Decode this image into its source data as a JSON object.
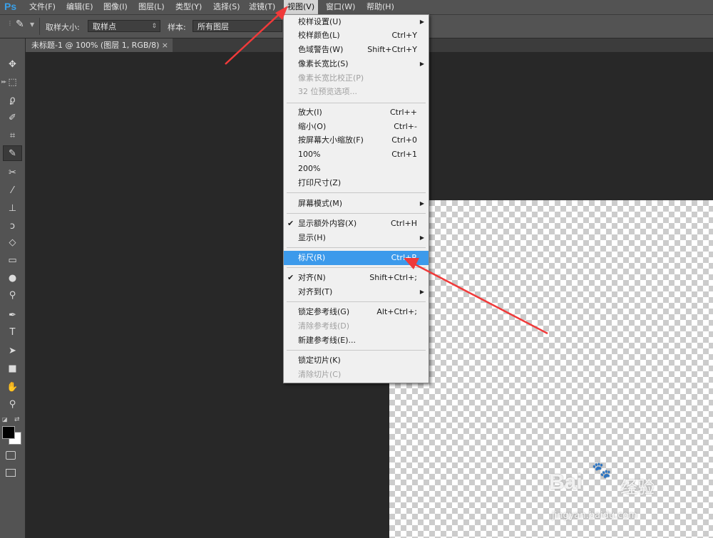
{
  "app": {
    "logo": "Ps"
  },
  "menubar": {
    "items": [
      "文件(F)",
      "编辑(E)",
      "图像(I)",
      "图层(L)",
      "类型(Y)",
      "选择(S)",
      "滤镜(T)",
      "视图(V)",
      "窗口(W)",
      "帮助(H)"
    ],
    "active": "视图(V)"
  },
  "options": {
    "sample_size_label": "取样大小:",
    "sample_size_value": "取样点",
    "sample_label": "样本:",
    "sample_value": "所有图层"
  },
  "document": {
    "tab_title": "未标题-1 @ 100% (图层 1, RGB/8)",
    "close": "×"
  },
  "toolbar": {
    "tools": [
      "move-tool",
      "marquee-tool",
      "lasso-tool",
      "quick-select-tool",
      "crop-tool",
      "eyedropper-tool",
      "healing-tool",
      "brush-tool",
      "stamp-tool",
      "history-brush-tool",
      "eraser-tool",
      "gradient-tool",
      "blur-tool",
      "dodge-tool",
      "pen-tool",
      "type-tool",
      "path-select-tool",
      "shape-tool",
      "hand-tool",
      "zoom-tool"
    ],
    "selected": "eyedropper-tool"
  },
  "view_menu": {
    "items": [
      {
        "label": "校样设置(U)",
        "shortcut": "",
        "submenu": true,
        "disabled": false
      },
      {
        "label": "校样颜色(L)",
        "shortcut": "Ctrl+Y",
        "disabled": false
      },
      {
        "label": "色域警告(W)",
        "shortcut": "Shift+Ctrl+Y",
        "disabled": false
      },
      {
        "label": "像素长宽比(S)",
        "shortcut": "",
        "submenu": true,
        "disabled": false
      },
      {
        "label": "像素长宽比校正(P)",
        "shortcut": "",
        "disabled": true
      },
      {
        "label": "32 位预览选项...",
        "shortcut": "",
        "disabled": true
      },
      {
        "label": "放大(I)",
        "shortcut": "Ctrl++",
        "disabled": false
      },
      {
        "label": "缩小(O)",
        "shortcut": "Ctrl+-",
        "disabled": false
      },
      {
        "label": "按屏幕大小缩放(F)",
        "shortcut": "Ctrl+0",
        "disabled": false
      },
      {
        "label": "100%",
        "shortcut": "Ctrl+1",
        "disabled": false
      },
      {
        "label": "200%",
        "shortcut": "",
        "disabled": false
      },
      {
        "label": "打印尺寸(Z)",
        "shortcut": "",
        "disabled": false
      },
      {
        "label": "屏幕模式(M)",
        "shortcut": "",
        "submenu": true,
        "disabled": false
      },
      {
        "label": "显示额外内容(X)",
        "shortcut": "Ctrl+H",
        "checked": true,
        "disabled": false
      },
      {
        "label": "显示(H)",
        "shortcut": "",
        "submenu": true,
        "disabled": false
      },
      {
        "label": "标尺(R)",
        "shortcut": "Ctrl+R",
        "highlighted": true,
        "disabled": false
      },
      {
        "label": "对齐(N)",
        "shortcut": "Shift+Ctrl+;",
        "checked": true,
        "disabled": false
      },
      {
        "label": "对齐到(T)",
        "shortcut": "",
        "submenu": true,
        "disabled": false
      },
      {
        "label": "锁定参考线(G)",
        "shortcut": "Alt+Ctrl+;",
        "disabled": false
      },
      {
        "label": "清除参考线(D)",
        "shortcut": "",
        "disabled": true
      },
      {
        "label": "新建参考线(E)...",
        "shortcut": "",
        "disabled": false
      },
      {
        "label": "锁定切片(K)",
        "shortcut": "",
        "disabled": false
      },
      {
        "label": "清除切片(C)",
        "shortcut": "",
        "disabled": true
      }
    ]
  },
  "watermark": {
    "brand": "Bai",
    "brand2": "经验",
    "url": "jingyan.baidu.com"
  },
  "colors": {
    "accent": "#3c9aeb",
    "arrow": "#f03a3a"
  }
}
